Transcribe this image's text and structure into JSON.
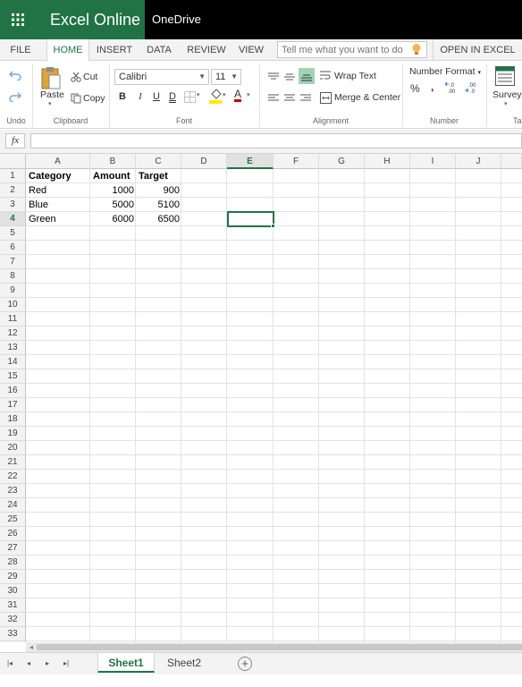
{
  "app": {
    "title": "Excel Online",
    "location": "OneDrive"
  },
  "ribbon_tabs": [
    {
      "label": "FILE",
      "active": false
    },
    {
      "label": "HOME",
      "active": true
    },
    {
      "label": "INSERT",
      "active": false
    },
    {
      "label": "DATA",
      "active": false
    },
    {
      "label": "REVIEW",
      "active": false
    },
    {
      "label": "VIEW",
      "active": false
    }
  ],
  "tellme": {
    "placeholder": "Tell me what you want to do"
  },
  "open_in_excel": "OPEN IN EXCEL",
  "ribbon": {
    "undo_group": "Undo",
    "clipboard": {
      "paste": "Paste",
      "cut": "Cut",
      "copy": "Copy",
      "label": "Clipboard"
    },
    "font": {
      "family": "Calibri",
      "size": "11",
      "bold": "B",
      "italic": "I",
      "underline": "U",
      "double_underline": "D",
      "font_color": "A",
      "label": "Font"
    },
    "alignment": {
      "wrap_text": "Wrap Text",
      "merge_center": "Merge & Center",
      "label": "Alignment"
    },
    "number": {
      "format": "Number Format",
      "percent": "%",
      "comma": ",",
      "label": "Number"
    },
    "tables": {
      "survey": "Survey",
      "label_partial": "Ta"
    }
  },
  "formula_bar": {
    "fx": "fx",
    "value": ""
  },
  "columns": [
    "A",
    "B",
    "C",
    "D",
    "E",
    "F",
    "G",
    "H",
    "I",
    "J"
  ],
  "selected_column": "E",
  "selected_row": 4,
  "row_count": 33,
  "cells": {
    "header": [
      "Category",
      "Amount",
      "Target"
    ],
    "rows": [
      [
        "Red",
        "1000",
        "900"
      ],
      [
        "Blue",
        "5000",
        "5100"
      ],
      [
        "Green",
        "6000",
        "6500"
      ]
    ]
  },
  "sheets": [
    {
      "name": "Sheet1",
      "active": true
    },
    {
      "name": "Sheet2",
      "active": false
    }
  ],
  "colors": {
    "accent": "#217346",
    "topbar": "#000000"
  }
}
